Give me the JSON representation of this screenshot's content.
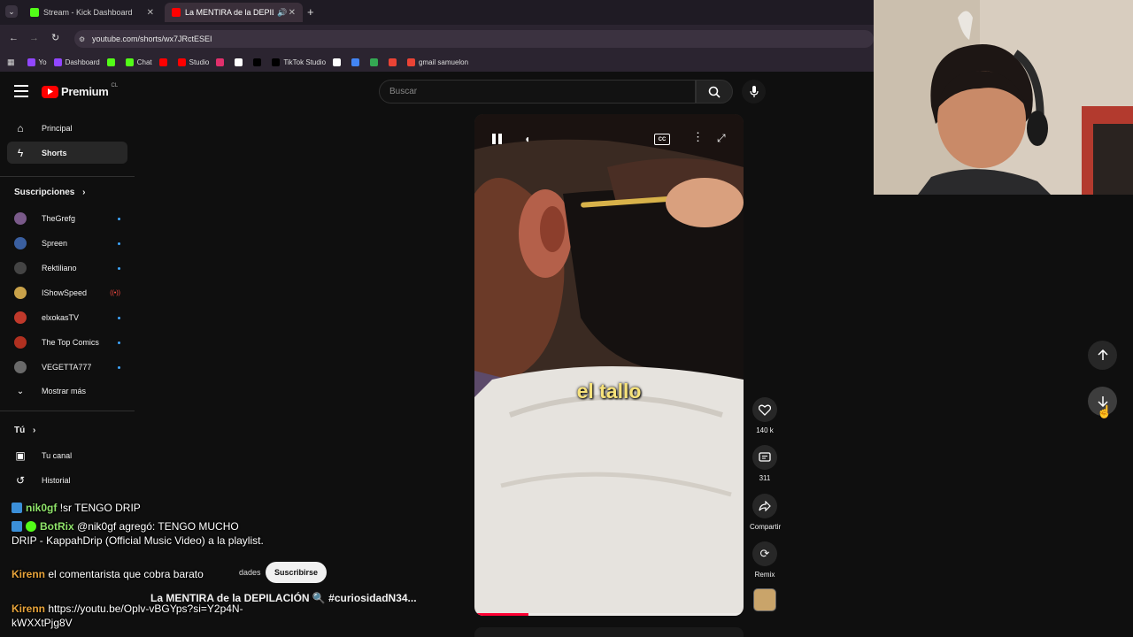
{
  "browser": {
    "tabs": [
      {
        "title": "Stream - Kick Dashboard",
        "favicon_color": "#53fc18",
        "active": false
      },
      {
        "title": "La MENTIRA de la DEPILACI",
        "favicon_color": "#ff0000",
        "active": true
      }
    ],
    "new_tab": "+",
    "url": "youtube.com/shorts/wx7JRctESEI",
    "bookmarks": [
      {
        "label": "Yo",
        "color": "#9146ff"
      },
      {
        "label": "Dashboard",
        "color": "#9146ff"
      },
      {
        "label": "",
        "color": "#53fc18"
      },
      {
        "label": "Chat",
        "color": "#53fc18"
      },
      {
        "label": "",
        "color": "#ff0000"
      },
      {
        "label": "Studio",
        "color": "#ff0000"
      },
      {
        "label": "",
        "color": "#e1306c"
      },
      {
        "label": "",
        "color": "#ffffff"
      },
      {
        "label": "",
        "color": "#000000"
      },
      {
        "label": "TikTok Studio",
        "color": "#000000"
      },
      {
        "label": "",
        "color": "#ffffff"
      },
      {
        "label": "",
        "color": "#4285f4"
      },
      {
        "label": "",
        "color": "#34a853"
      },
      {
        "label": "",
        "color": "#ea4335"
      },
      {
        "label": "gmail samuelon",
        "color": "#ea4335"
      }
    ]
  },
  "youtube": {
    "logo_text": "Premium",
    "logo_superscript": "CL",
    "search_placeholder": "Buscar",
    "nav": [
      {
        "label": "Principal",
        "icon": "home-icon"
      },
      {
        "label": "Shorts",
        "icon": "shorts-icon"
      }
    ],
    "subscriptions_header": "Suscripciones",
    "subscriptions": [
      {
        "name": "TheGrefg",
        "color": "#7a5a8a",
        "live": false
      },
      {
        "name": "Spreen",
        "color": "#3a5fa0",
        "live": false
      },
      {
        "name": "Rektiliano",
        "color": "#444444",
        "live": false
      },
      {
        "name": "IShowSpeed",
        "color": "#c9a24a",
        "live": true
      },
      {
        "name": "elxokasTV",
        "color": "#c0392b",
        "live": false
      },
      {
        "name": "The Top Comics",
        "color": "#b03020",
        "live": false
      },
      {
        "name": "VEGETTA777",
        "color": "#6a6a6a",
        "live": false
      }
    ],
    "show_more": "Mostrar más",
    "you_header": "Tú",
    "you_items": [
      {
        "label": "Tu canal",
        "icon": "channel-icon"
      },
      {
        "label": "Historial",
        "icon": "history-icon"
      }
    ],
    "video": {
      "caption": "el tallo",
      "title": "La MENTIRA de la DEPILACIÓN 🔍 #curiosidadN34...",
      "subscribe": "Suscribirse",
      "channel_fragment": "dades",
      "progress": 0.2
    },
    "actions": [
      {
        "label": "140 k",
        "icon": "like-icon"
      },
      {
        "label": "311",
        "icon": "comment-icon"
      },
      {
        "label": "Compartir",
        "icon": "share-icon"
      },
      {
        "label": "Remix",
        "icon": "remix-icon"
      }
    ]
  },
  "chat": [
    {
      "user": "nik0gf",
      "user_color": "#8fe36a",
      "message": "!sr TENGO DRIP"
    },
    {
      "user": "BotRix",
      "user_color": "#8fe36a",
      "message": "@nik0gf agregó: TENGO MUCHO DRIP - KappahDrip (Official Music Video) a la playlist."
    },
    {
      "user": "Kirenn",
      "user_color": "#e7a33a",
      "message": "el comentarista que cobra barato"
    },
    {
      "user": "Kirenn",
      "user_color": "#e7a33a",
      "message": "https://youtu.be/Oplv-vBGYps?si=Y2p4N-kWXXtPjg8V"
    }
  ]
}
